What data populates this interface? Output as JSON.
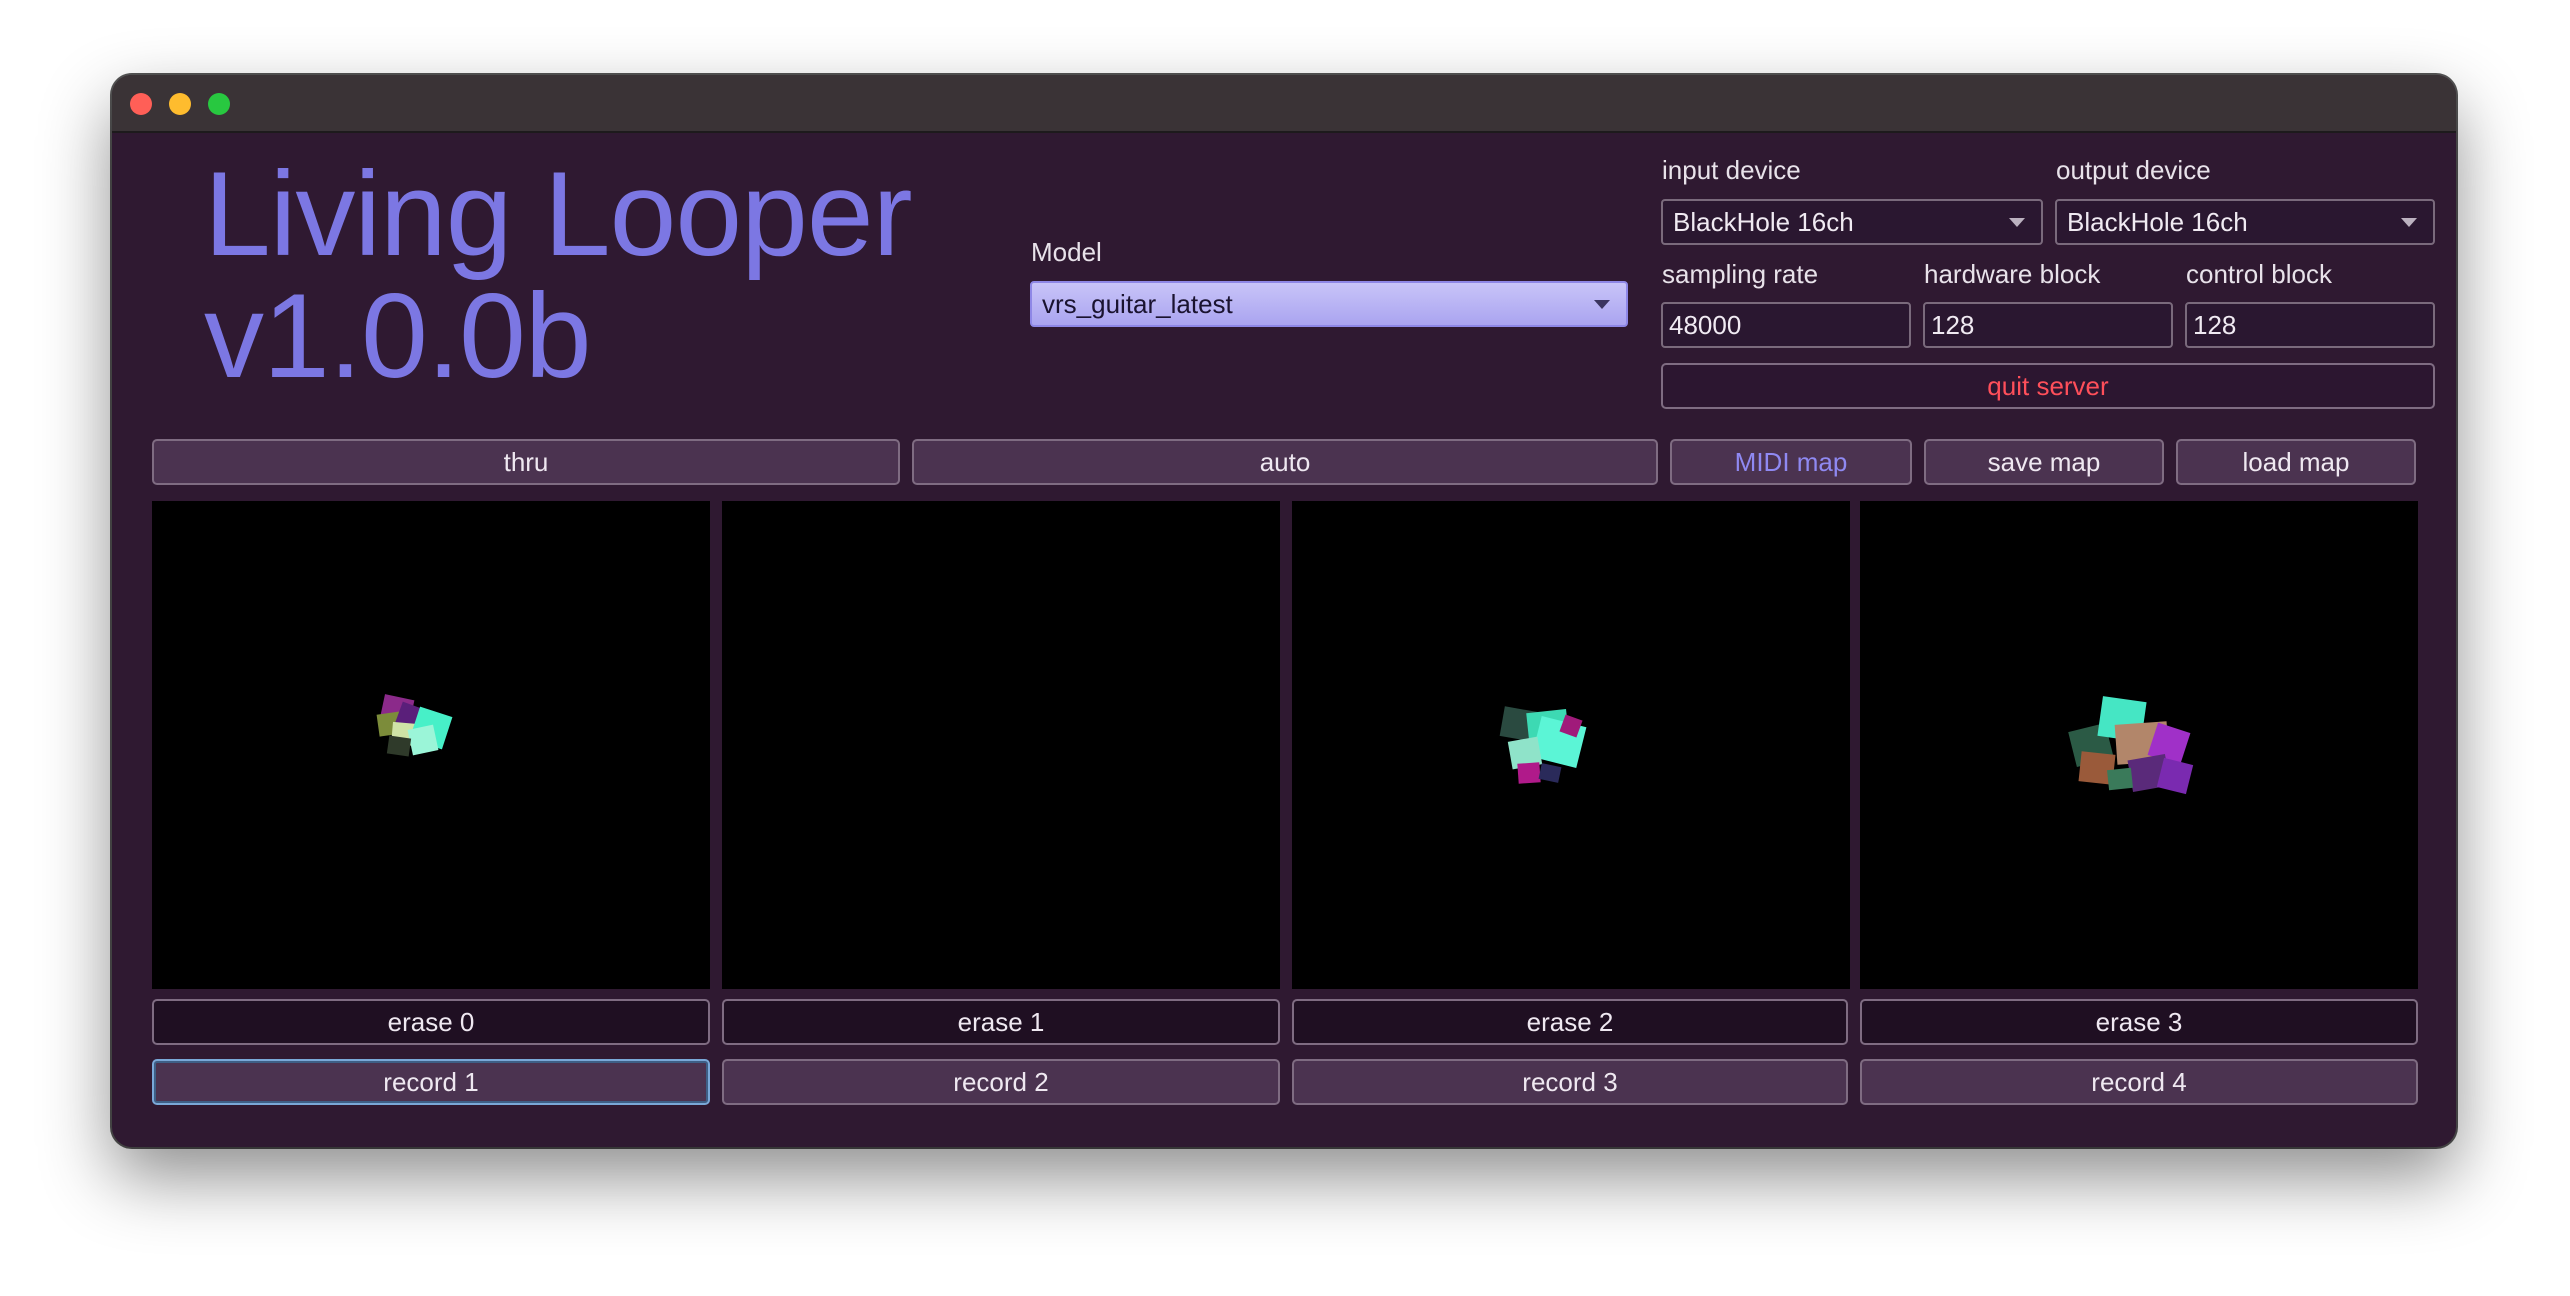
{
  "app": {
    "title_line1": "Living Looper",
    "title_line2": "v1.0.0b"
  },
  "window_controls": {
    "close": "close-icon",
    "minimize": "minimize-icon",
    "maximize": "maximize-icon"
  },
  "model": {
    "label": "Model",
    "value": "vrs_guitar_latest"
  },
  "devices": {
    "input_label": "input device",
    "input_value": "BlackHole 16ch",
    "output_label": "output device",
    "output_value": "BlackHole 16ch"
  },
  "audio": {
    "sampling_rate_label": "sampling rate",
    "sampling_rate_value": "48000",
    "hardware_block_label": "hardware block",
    "hardware_block_value": "128",
    "control_block_label": "control block",
    "control_block_value": "128"
  },
  "server": {
    "quit_label": "quit server"
  },
  "toolbar": {
    "thru": "thru",
    "auto": "auto",
    "midi_map": "MIDI map",
    "save_map": "save map",
    "load_map": "load map"
  },
  "loops": [
    {
      "erase": "erase 0",
      "record": "record 1"
    },
    {
      "erase": "erase 1",
      "record": "record 2"
    },
    {
      "erase": "erase 2",
      "record": "record 3"
    },
    {
      "erase": "erase 3",
      "record": "record 4"
    }
  ],
  "colors": {
    "background": "#2f1931",
    "title": "#7c77e3",
    "quit": "#ff4f5a",
    "midi_map": "#8f89f2",
    "model_select": "#b8b3f5"
  }
}
